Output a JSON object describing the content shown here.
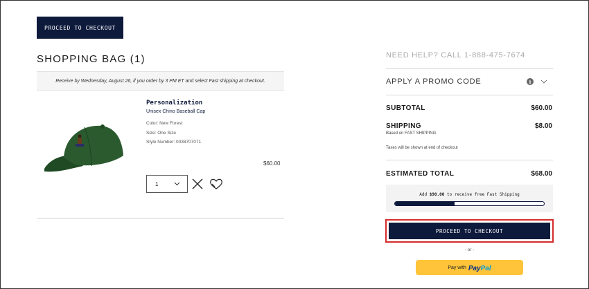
{
  "header": {
    "checkout_label": "PROCEED TO CHECKOUT"
  },
  "bag": {
    "title": "SHOPPING BAG (1)",
    "delivery_notice": "Receive by Wednesday, August 26, if you order by 3 PM ET and select Fast shipping at checkout."
  },
  "item": {
    "image_icon": "baseball-cap-image",
    "personalization": "Personalization",
    "name": "Unisex Chino Baseball Cap",
    "color": "Color: New Forest",
    "size": "Size: One Size",
    "style": "Style Number: 0038707071",
    "price": "$60.00",
    "quantity": "1",
    "remove_icon": "close-icon",
    "wishlist_icon": "heart-icon"
  },
  "summary": {
    "help": "NEED HELP? CALL 1-888-475-7674",
    "promo": "APPLY A PROMO CODE",
    "subtotal_label": "SUBTOTAL",
    "subtotal_value": "$60.00",
    "shipping_label": "SHIPPING",
    "shipping_value": "$8.00",
    "shipping_method": "Based on FAST SHIPPING",
    "tax_note": "Taxes will be shown at end of checkout",
    "total_label": "ESTIMATED TOTAL",
    "total_value": "$68.00",
    "free_ship_prefix": "Add",
    "free_ship_amount": "$90.00",
    "free_ship_suffix": "to receive free Fast Shipping",
    "free_ship_progress": 0.4,
    "checkout_label": "PROCEED TO CHECKOUT",
    "or_label": "- or -",
    "paypal_with": "Pay with",
    "paypal_pay": "Pay",
    "paypal_pal": "Pal"
  },
  "colors": {
    "navy": "#0e1a3c",
    "highlight": "#d62b2b",
    "paypal_yellow": "#ffc439"
  }
}
